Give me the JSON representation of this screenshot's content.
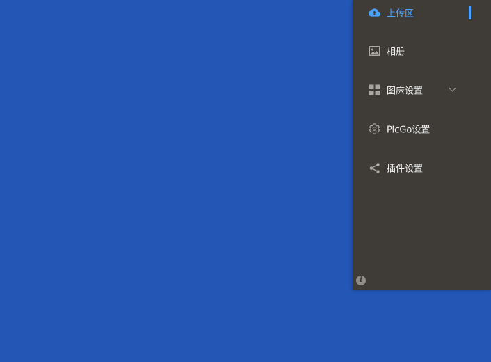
{
  "window": {
    "desktop_color": "#2356b5",
    "sidebar_color": "#3f3c37",
    "accent_color": "#4aa3ff"
  },
  "sidebar": {
    "items": [
      {
        "label": "上传区",
        "icon": "cloud-upload-icon",
        "active": true
      },
      {
        "label": "相册",
        "icon": "image-icon",
        "active": false
      },
      {
        "label": "图床设置",
        "icon": "grid-icon",
        "active": false,
        "expandable": true
      },
      {
        "label": "PicGo设置",
        "icon": "gear-icon",
        "active": false
      },
      {
        "label": "插件设置",
        "icon": "share-icon",
        "active": false
      }
    ],
    "info_icon": "info-icon",
    "info_glyph": "i"
  }
}
